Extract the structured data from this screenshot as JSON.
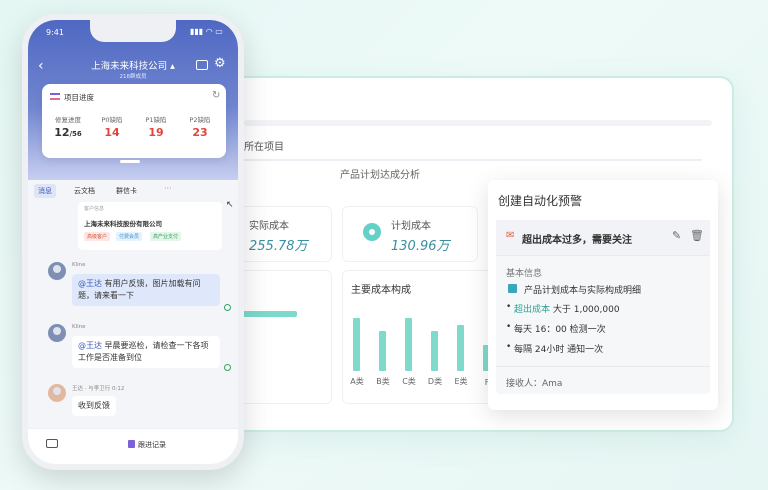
{
  "dashboard": {
    "tab": "所在项目",
    "subtitle": "产品计划达成分析",
    "kpis": [
      {
        "title": "实际成本",
        "value": "255.78万"
      },
      {
        "title": "计划成本",
        "value": "130.96万"
      }
    ],
    "cost_panel_title": "主要成本构成",
    "chart_data": {
      "type": "bar",
      "title": "主要成本构成",
      "categories": [
        "A类",
        "B类",
        "C类",
        "D类",
        "E类",
        "F"
      ],
      "values": [
        80,
        60,
        80,
        60,
        70,
        40
      ],
      "ylim": [
        0,
        100
      ]
    },
    "colors": {
      "accent": "#7fdacc",
      "value": "#3a8fa0"
    }
  },
  "alert": {
    "title": "创建自动化预警",
    "rule_icon": "warning-icon",
    "rule_name": "超出成本过多，需要关注",
    "section": "基本信息",
    "source": "产品计划成本与实际构成明细",
    "cond_accent": "超出成本",
    "cond_rest": " 大于 1,000,000",
    "schedule": "每天 16：00 检测一次",
    "notify": "每隔 24小时 通知一次",
    "receiver": "接收人：Ama"
  },
  "phone": {
    "time": "9:41",
    "status_icons": "▮▮▮ ◠ ▭",
    "company": "上海未来科技公司 ▴",
    "company_sub": "218群成员",
    "stats_title": "项目进度",
    "stats": [
      {
        "label": "修复进度",
        "value": "12",
        "suffix": "/56"
      },
      {
        "label": "P0缺陷",
        "value": "14"
      },
      {
        "label": "P1缺陷",
        "value": "19"
      },
      {
        "label": "P2缺陷",
        "value": "23"
      }
    ],
    "tabs": [
      "消息",
      "云文档",
      "群信卡"
    ],
    "more": "···",
    "card": {
      "tag": "客户信息",
      "company": "上海未来科技股份有限公司",
      "chips": [
        "高级客户",
        "付费会员",
        "高产业支付"
      ]
    },
    "messages": [
      {
        "sender": "Kline",
        "mention": "@王达",
        "text": " 有用户反馈，图片加载有问题，请来看一下"
      },
      {
        "sender": "Kline",
        "mention": "@王达",
        "text": " 早晨要巡检，请检查一下各项工作是否准备到位"
      },
      {
        "sender": "王达 · 与李卫行 0:12",
        "mention": "",
        "text": "收到反馈"
      }
    ],
    "follow_label": "跟进记录"
  }
}
